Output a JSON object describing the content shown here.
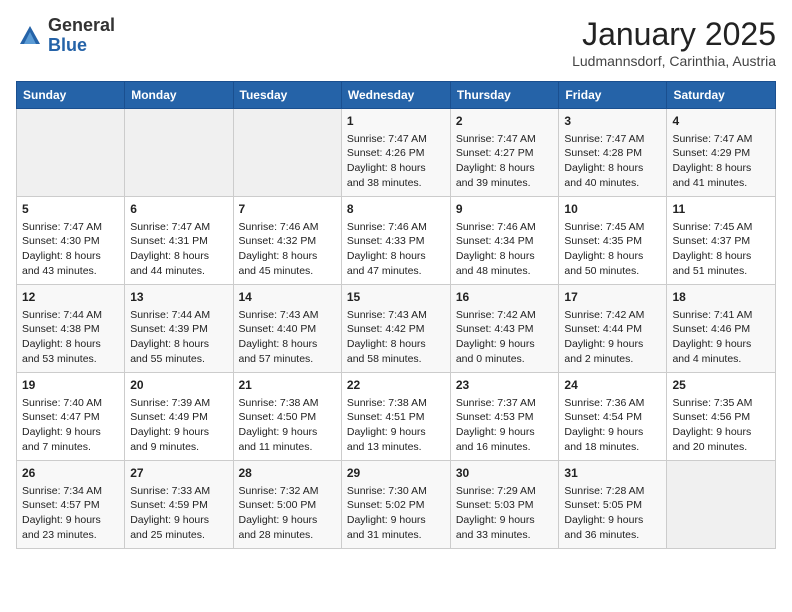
{
  "header": {
    "logo_general": "General",
    "logo_blue": "Blue",
    "title": "January 2025",
    "subtitle": "Ludmannsdorf, Carinthia, Austria"
  },
  "days_of_week": [
    "Sunday",
    "Monday",
    "Tuesday",
    "Wednesday",
    "Thursday",
    "Friday",
    "Saturday"
  ],
  "weeks": [
    [
      {
        "day": "",
        "info": ""
      },
      {
        "day": "",
        "info": ""
      },
      {
        "day": "",
        "info": ""
      },
      {
        "day": "1",
        "info": "Sunrise: 7:47 AM\nSunset: 4:26 PM\nDaylight: 8 hours and 38 minutes."
      },
      {
        "day": "2",
        "info": "Sunrise: 7:47 AM\nSunset: 4:27 PM\nDaylight: 8 hours and 39 minutes."
      },
      {
        "day": "3",
        "info": "Sunrise: 7:47 AM\nSunset: 4:28 PM\nDaylight: 8 hours and 40 minutes."
      },
      {
        "day": "4",
        "info": "Sunrise: 7:47 AM\nSunset: 4:29 PM\nDaylight: 8 hours and 41 minutes."
      }
    ],
    [
      {
        "day": "5",
        "info": "Sunrise: 7:47 AM\nSunset: 4:30 PM\nDaylight: 8 hours and 43 minutes."
      },
      {
        "day": "6",
        "info": "Sunrise: 7:47 AM\nSunset: 4:31 PM\nDaylight: 8 hours and 44 minutes."
      },
      {
        "day": "7",
        "info": "Sunrise: 7:46 AM\nSunset: 4:32 PM\nDaylight: 8 hours and 45 minutes."
      },
      {
        "day": "8",
        "info": "Sunrise: 7:46 AM\nSunset: 4:33 PM\nDaylight: 8 hours and 47 minutes."
      },
      {
        "day": "9",
        "info": "Sunrise: 7:46 AM\nSunset: 4:34 PM\nDaylight: 8 hours and 48 minutes."
      },
      {
        "day": "10",
        "info": "Sunrise: 7:45 AM\nSunset: 4:35 PM\nDaylight: 8 hours and 50 minutes."
      },
      {
        "day": "11",
        "info": "Sunrise: 7:45 AM\nSunset: 4:37 PM\nDaylight: 8 hours and 51 minutes."
      }
    ],
    [
      {
        "day": "12",
        "info": "Sunrise: 7:44 AM\nSunset: 4:38 PM\nDaylight: 8 hours and 53 minutes."
      },
      {
        "day": "13",
        "info": "Sunrise: 7:44 AM\nSunset: 4:39 PM\nDaylight: 8 hours and 55 minutes."
      },
      {
        "day": "14",
        "info": "Sunrise: 7:43 AM\nSunset: 4:40 PM\nDaylight: 8 hours and 57 minutes."
      },
      {
        "day": "15",
        "info": "Sunrise: 7:43 AM\nSunset: 4:42 PM\nDaylight: 8 hours and 58 minutes."
      },
      {
        "day": "16",
        "info": "Sunrise: 7:42 AM\nSunset: 4:43 PM\nDaylight: 9 hours and 0 minutes."
      },
      {
        "day": "17",
        "info": "Sunrise: 7:42 AM\nSunset: 4:44 PM\nDaylight: 9 hours and 2 minutes."
      },
      {
        "day": "18",
        "info": "Sunrise: 7:41 AM\nSunset: 4:46 PM\nDaylight: 9 hours and 4 minutes."
      }
    ],
    [
      {
        "day": "19",
        "info": "Sunrise: 7:40 AM\nSunset: 4:47 PM\nDaylight: 9 hours and 7 minutes."
      },
      {
        "day": "20",
        "info": "Sunrise: 7:39 AM\nSunset: 4:49 PM\nDaylight: 9 hours and 9 minutes."
      },
      {
        "day": "21",
        "info": "Sunrise: 7:38 AM\nSunset: 4:50 PM\nDaylight: 9 hours and 11 minutes."
      },
      {
        "day": "22",
        "info": "Sunrise: 7:38 AM\nSunset: 4:51 PM\nDaylight: 9 hours and 13 minutes."
      },
      {
        "day": "23",
        "info": "Sunrise: 7:37 AM\nSunset: 4:53 PM\nDaylight: 9 hours and 16 minutes."
      },
      {
        "day": "24",
        "info": "Sunrise: 7:36 AM\nSunset: 4:54 PM\nDaylight: 9 hours and 18 minutes."
      },
      {
        "day": "25",
        "info": "Sunrise: 7:35 AM\nSunset: 4:56 PM\nDaylight: 9 hours and 20 minutes."
      }
    ],
    [
      {
        "day": "26",
        "info": "Sunrise: 7:34 AM\nSunset: 4:57 PM\nDaylight: 9 hours and 23 minutes."
      },
      {
        "day": "27",
        "info": "Sunrise: 7:33 AM\nSunset: 4:59 PM\nDaylight: 9 hours and 25 minutes."
      },
      {
        "day": "28",
        "info": "Sunrise: 7:32 AM\nSunset: 5:00 PM\nDaylight: 9 hours and 28 minutes."
      },
      {
        "day": "29",
        "info": "Sunrise: 7:30 AM\nSunset: 5:02 PM\nDaylight: 9 hours and 31 minutes."
      },
      {
        "day": "30",
        "info": "Sunrise: 7:29 AM\nSunset: 5:03 PM\nDaylight: 9 hours and 33 minutes."
      },
      {
        "day": "31",
        "info": "Sunrise: 7:28 AM\nSunset: 5:05 PM\nDaylight: 9 hours and 36 minutes."
      },
      {
        "day": "",
        "info": ""
      }
    ]
  ]
}
